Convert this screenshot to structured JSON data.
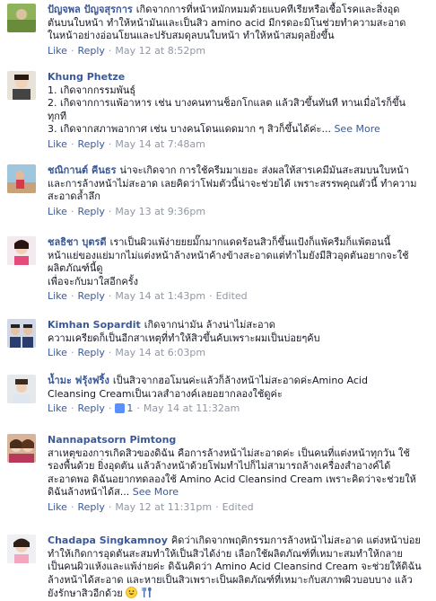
{
  "ui": {
    "like": "Like",
    "reply": "Reply",
    "dot": "·",
    "edited": "Edited",
    "see_more": "See More"
  },
  "comments": [
    {
      "author": "ปัญจพล ปัญจสุรการ",
      "lines": [
        "เกิดจากการที่หน้าหมักหมมด้วยแบคทีเรียหรือเชื้อโรคและสิ่งอุด",
        "ตันบนใบหน้า ทำให้หน้ามันและเป็นสิว amino acid มีกรดอะมิโนช่วยทำความสะอาด",
        "ในหน้าอย่างอ่อนโยนและปรับสมดุลบนใบหน้า ทำให้หน้าสมดุลยิ่งขึ้น"
      ],
      "timestamp": "May 12 at 8:52pm"
    },
    {
      "author": "Khung Phetze",
      "lines": [
        "1. เกิดจากกรรมพันธุ์",
        "2. เกิดจากการแพ้อาหาร เช่น บางคนทานช็อกโกแลต แล้วสิวขึ้นทันที ทานเมื่อไรก็ขึ้น",
        "ทุกที",
        "3. เกิดจากสภาพอากาศ เช่น บางคนโดนแดดมาก ๆ สิวก็ขึ้นได้ค่ะ..."
      ],
      "see_more": true,
      "timestamp": "May 14 at 7:48am"
    },
    {
      "author": "ชณิกานต์ คีนธร",
      "lines": [
        "น่าจะเกิดจาก การใช้ครีมมาเยอะ ส่งผลให้สารเคมีมันสะสมบนใบหน้า",
        "และการล้างหน้าไม่สะอาด เลยคิดว่าโฟมตัวนี้น่าจะช่วยได้ เพราะสรรพคุณตัวนี้ ทำความ",
        "สะอาดล้ำลึก"
      ],
      "timestamp": "May 13 at 9:36pm"
    },
    {
      "author": "ชลธิชา บุตรดี",
      "lines": [
        "เราเป็นผิวแพ้ง่ายยยมั๊กมากแดดร้อนสิวก็ขึ้นแป้งก็แพ้ครีมก็แพ้ตอนนี้",
        "หน้าแย่ของแย่มากไม่แต่งหน้าล้างหน้าค้างข้างสะอาดแต่ทำไมยังมีสิวอุดตันอยากจะใช้",
        "ผลิตภัณฑ์นี้ดู",
        "เพื่อจะกับมาใสอีกครั้ง"
      ],
      "timestamp": "May 14 at 1:43pm",
      "edited": true
    },
    {
      "author": "Kimhan Sopardit",
      "lines": [
        "เกิดจากน่ามัน ล้างน่าไม่สะอาด",
        "ความเครียดก็เป็นอีกสาเหตุที่ทำให้สิวขึ้นค้บเพราะผมเป็นบ่อยๆค้บ"
      ],
      "timestamp": "May 14 at 6:03pm"
    },
    {
      "author": "น้ำมะ ฟรุ้งฟริ้ง",
      "lines": [
        "เป็นสิวจากฮอโมนค่ะแล้วก็ล้างหน้าไม่สะอาดค่ะAmino Acid",
        "Cleansing Creamเป็นเวลสำอางค์เลยอยากลองใช้ดูค่ะ"
      ],
      "timestamp": "May 14 at 11:32am",
      "likes": "1"
    },
    {
      "author": "Nannapatsorn Pimtong",
      "lines": [
        "สาเหตุของการเกิดสิวของดิฉัน คือการล้างหน้าไม่สะอาดค่ะ เป็นคนที่แต่งหน้าทุกวัน ใช้",
        "รองพื้นด้วย ยิ่งอุดตัน แล้วล้างหน้าด้วยโฟมทำไปก็ไม่สามารถล้างเครื่องสำอางค์ได้",
        "สะอาดพอ ดิฉันอยากทดลองใช้ Amino Acid Cleansind Cream เพราะคิดว่าจะช่วยให้",
        "ดิฉันล้างหน้าได้ส..."
      ],
      "see_more": true,
      "timestamp": "May 12 at 11:31pm",
      "edited": true
    },
    {
      "author": "Chadapa Singkamnoy",
      "lines": [
        "คิดว่าเกิดจากพฤติกรรมการล้างหน้าไม่สะอาด แต่งหน้าบ่อย",
        "ทำให้เกิดการอุดตันสะสมทำให้เป็นสิวได้ง่าย เลือกใช้ผลิตภัณฑ์ที่เหมาะสมทำให้กลาย",
        "เป็นคนผิวแห้งและแพ้ง่ายค่ะ ดิฉันคิดว่า Amino Acid Cleansind Cream จะช่วยให้ดิฉัน",
        "ล้างหน้าได้สะอาด และหายเป็นสิวเพราะเป็นผลิตภัณฑ์ที่เหมาะกับสภาพผิวบอบบาง แล้ว",
        "ยังรักษาสิวอีกด้วย"
      ],
      "emoji": true
    }
  ]
}
